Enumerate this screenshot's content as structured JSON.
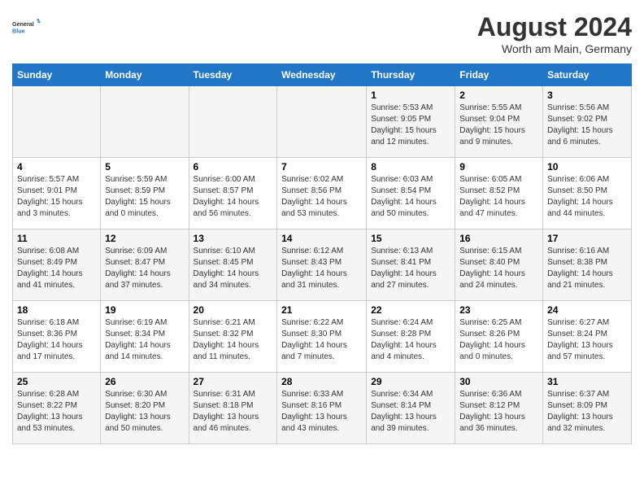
{
  "header": {
    "logo_line1": "General",
    "logo_line2": "Blue",
    "month_year": "August 2024",
    "location": "Worth am Main, Germany"
  },
  "days_of_week": [
    "Sunday",
    "Monday",
    "Tuesday",
    "Wednesday",
    "Thursday",
    "Friday",
    "Saturday"
  ],
  "weeks": [
    [
      {
        "day": "",
        "info": ""
      },
      {
        "day": "",
        "info": ""
      },
      {
        "day": "",
        "info": ""
      },
      {
        "day": "",
        "info": ""
      },
      {
        "day": "1",
        "info": "Sunrise: 5:53 AM\nSunset: 9:05 PM\nDaylight: 15 hours and 12 minutes."
      },
      {
        "day": "2",
        "info": "Sunrise: 5:55 AM\nSunset: 9:04 PM\nDaylight: 15 hours and 9 minutes."
      },
      {
        "day": "3",
        "info": "Sunrise: 5:56 AM\nSunset: 9:02 PM\nDaylight: 15 hours and 6 minutes."
      }
    ],
    [
      {
        "day": "4",
        "info": "Sunrise: 5:57 AM\nSunset: 9:01 PM\nDaylight: 15 hours and 3 minutes."
      },
      {
        "day": "5",
        "info": "Sunrise: 5:59 AM\nSunset: 8:59 PM\nDaylight: 15 hours and 0 minutes."
      },
      {
        "day": "6",
        "info": "Sunrise: 6:00 AM\nSunset: 8:57 PM\nDaylight: 14 hours and 56 minutes."
      },
      {
        "day": "7",
        "info": "Sunrise: 6:02 AM\nSunset: 8:56 PM\nDaylight: 14 hours and 53 minutes."
      },
      {
        "day": "8",
        "info": "Sunrise: 6:03 AM\nSunset: 8:54 PM\nDaylight: 14 hours and 50 minutes."
      },
      {
        "day": "9",
        "info": "Sunrise: 6:05 AM\nSunset: 8:52 PM\nDaylight: 14 hours and 47 minutes."
      },
      {
        "day": "10",
        "info": "Sunrise: 6:06 AM\nSunset: 8:50 PM\nDaylight: 14 hours and 44 minutes."
      }
    ],
    [
      {
        "day": "11",
        "info": "Sunrise: 6:08 AM\nSunset: 8:49 PM\nDaylight: 14 hours and 41 minutes."
      },
      {
        "day": "12",
        "info": "Sunrise: 6:09 AM\nSunset: 8:47 PM\nDaylight: 14 hours and 37 minutes."
      },
      {
        "day": "13",
        "info": "Sunrise: 6:10 AM\nSunset: 8:45 PM\nDaylight: 14 hours and 34 minutes."
      },
      {
        "day": "14",
        "info": "Sunrise: 6:12 AM\nSunset: 8:43 PM\nDaylight: 14 hours and 31 minutes."
      },
      {
        "day": "15",
        "info": "Sunrise: 6:13 AM\nSunset: 8:41 PM\nDaylight: 14 hours and 27 minutes."
      },
      {
        "day": "16",
        "info": "Sunrise: 6:15 AM\nSunset: 8:40 PM\nDaylight: 14 hours and 24 minutes."
      },
      {
        "day": "17",
        "info": "Sunrise: 6:16 AM\nSunset: 8:38 PM\nDaylight: 14 hours and 21 minutes."
      }
    ],
    [
      {
        "day": "18",
        "info": "Sunrise: 6:18 AM\nSunset: 8:36 PM\nDaylight: 14 hours and 17 minutes."
      },
      {
        "day": "19",
        "info": "Sunrise: 6:19 AM\nSunset: 8:34 PM\nDaylight: 14 hours and 14 minutes."
      },
      {
        "day": "20",
        "info": "Sunrise: 6:21 AM\nSunset: 8:32 PM\nDaylight: 14 hours and 11 minutes."
      },
      {
        "day": "21",
        "info": "Sunrise: 6:22 AM\nSunset: 8:30 PM\nDaylight: 14 hours and 7 minutes."
      },
      {
        "day": "22",
        "info": "Sunrise: 6:24 AM\nSunset: 8:28 PM\nDaylight: 14 hours and 4 minutes."
      },
      {
        "day": "23",
        "info": "Sunrise: 6:25 AM\nSunset: 8:26 PM\nDaylight: 14 hours and 0 minutes."
      },
      {
        "day": "24",
        "info": "Sunrise: 6:27 AM\nSunset: 8:24 PM\nDaylight: 13 hours and 57 minutes."
      }
    ],
    [
      {
        "day": "25",
        "info": "Sunrise: 6:28 AM\nSunset: 8:22 PM\nDaylight: 13 hours and 53 minutes."
      },
      {
        "day": "26",
        "info": "Sunrise: 6:30 AM\nSunset: 8:20 PM\nDaylight: 13 hours and 50 minutes."
      },
      {
        "day": "27",
        "info": "Sunrise: 6:31 AM\nSunset: 8:18 PM\nDaylight: 13 hours and 46 minutes."
      },
      {
        "day": "28",
        "info": "Sunrise: 6:33 AM\nSunset: 8:16 PM\nDaylight: 13 hours and 43 minutes."
      },
      {
        "day": "29",
        "info": "Sunrise: 6:34 AM\nSunset: 8:14 PM\nDaylight: 13 hours and 39 minutes."
      },
      {
        "day": "30",
        "info": "Sunrise: 6:36 AM\nSunset: 8:12 PM\nDaylight: 13 hours and 36 minutes."
      },
      {
        "day": "31",
        "info": "Sunrise: 6:37 AM\nSunset: 8:09 PM\nDaylight: 13 hours and 32 minutes."
      }
    ]
  ]
}
